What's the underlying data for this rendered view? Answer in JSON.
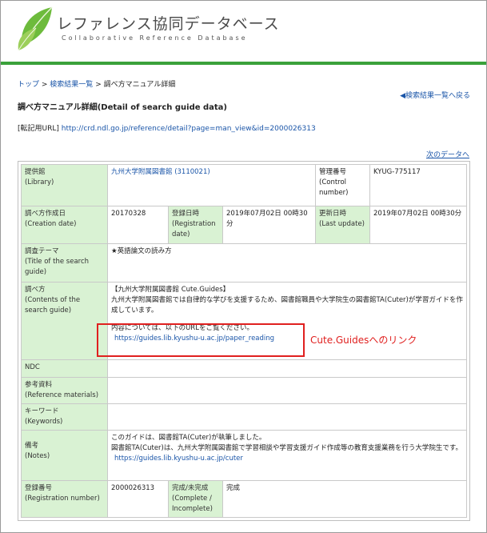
{
  "header": {
    "site_title": "レファレンス協同データベース",
    "site_subtitle": "Collaborative Reference Database",
    "brand_color": "#3aa13a"
  },
  "breadcrumb": {
    "top": "トップ",
    "search_results": "検索結果一覧",
    "current": "調べ方マニュアル詳細"
  },
  "back_link": "◀検索結果一覧へ戻る",
  "page_title": "調べ方マニュアル詳細(Detail of search guide data)",
  "permalink": {
    "label": "[転記用URL]",
    "url": "http://crd.ndl.go.jp/reference/detail?page=man_view&id=2000026313"
  },
  "next_data_link": "次のデータへ",
  "detail": {
    "library_label": "提供館",
    "library_label_en": "(Library)",
    "library_value": "九州大学附属図書館 (3110021)",
    "control_label": "管理番号",
    "control_label_en": "(Control number)",
    "control_value": "KYUG-775117",
    "created_label": "調べ方作成日",
    "created_label_en": "(Creation date)",
    "created_value": "20170328",
    "registered_label": "登録日時",
    "registered_label_en": "(Registration date)",
    "registered_value": "2019年07月02日 00時30分",
    "updated_label": "更新日時",
    "updated_label_en": "(Last update)",
    "updated_value": "2019年07月02日 00時30分",
    "theme_label": "調査テーマ",
    "theme_label_en": "(Title of the search guide)",
    "theme_value": "★英語論文の読み方",
    "contents_label": "調べ方",
    "contents_label_en": "(Contents of the search guide)",
    "contents_line1": "【九州大学附属図書館 Cute.Guides】",
    "contents_line2": "九州大学附属図書館では自律的な学びを支援するため、図書館職員や大学院生の図書館TA(Cuter)が学習ガイドを作成しています。",
    "contents_line3": "内容については、以下のURLをご覧ください。",
    "contents_url": "https://guides.lib.kyushu-u.ac.jp/paper_reading",
    "ndc_label": "NDC",
    "ndc_value": "",
    "ref_label": "参考資料",
    "ref_label_en": "(Reference materials)",
    "ref_value": "",
    "keywords_label": "キーワード",
    "keywords_label_en": "(Keywords)",
    "keywords_value": "",
    "notes_label": "備考",
    "notes_label_en": "(Notes)",
    "notes_line1": "このガイドは、図書館TA(Cuter)が執筆しました。",
    "notes_line2": "図書館TA(Cuter)は、九州大学附属図書館で学習相談や学習支援ガイド作成等の教育支援業務を行う大学院生です。",
    "notes_url": "https://guides.lib.kyushu-u.ac.jp/cuter",
    "regno_label": "登録番号",
    "regno_label_en": "(Registration number)",
    "regno_value": "2000026313",
    "complete_label": "完成/未完成",
    "complete_label_en": "(Complete / Incomplete)",
    "complete_value": "完成"
  },
  "annotation": {
    "text": "Cute.Guidesへのリンク",
    "color": "#e0201f"
  }
}
